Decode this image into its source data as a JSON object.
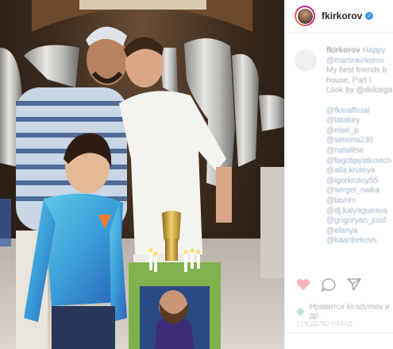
{
  "post": {
    "username": "fkirkorov",
    "verified_icon": "verified-badge-icon",
    "caption_user": "fkirkorov",
    "caption_lines": [
      "Happy",
      "@martinkirkorov",
      "My best friends b",
      "house, Part I",
      "Look by @dolcega",
      "",
      "@fkmafficial",
      "@tatakey",
      "@eteri_p",
      "@simona230",
      "@natalitse",
      "@fagotipyatkovich",
      "@alla.kruteya",
      "@igorkrutoy55",
      "@sergei_naika",
      "@tavrim",
      "@dj.kalyagueava",
      "@grigoryan_josif",
      "@elanya",
      "@kaanbekovs"
    ],
    "likes_text": "Нравится kiradymov и др.",
    "timestamp": "1 НЕДЕЛЮ НАЗАД"
  },
  "colors": {
    "verified": "#3897f0",
    "link": "#003569",
    "border": "#efefef"
  }
}
